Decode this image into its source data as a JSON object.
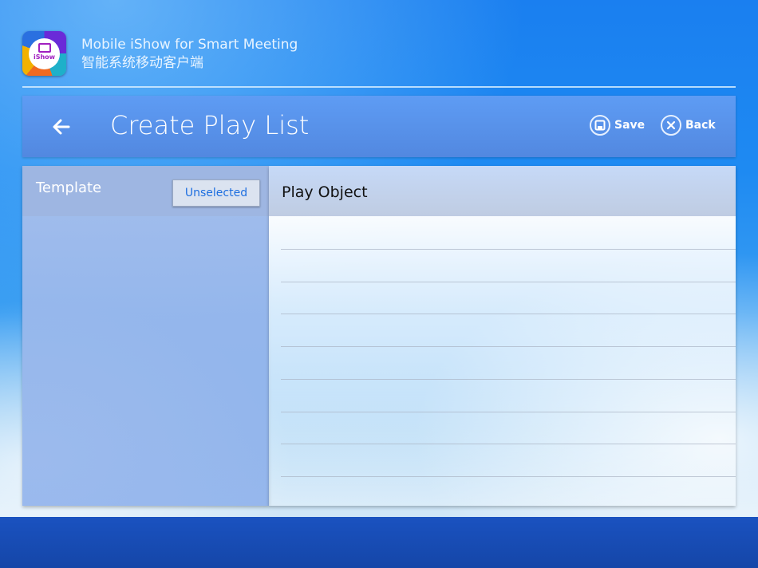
{
  "app": {
    "logo_text": "iShow",
    "title_en": "Mobile iShow for Smart Meeting",
    "title_cn": "智能系统移动客户端"
  },
  "toolbar": {
    "title": "Create Play List",
    "save_label": "Save",
    "back_label": "Back",
    "back_icon": "arrow-left-icon"
  },
  "template": {
    "label": "Template",
    "button_label": "Unselected"
  },
  "play_object": {
    "label": "Play Object",
    "rows": [
      "",
      "",
      "",
      "",
      "",
      "",
      "",
      "",
      ""
    ]
  },
  "colors": {
    "toolbar": "#5b95ec",
    "bottom_bar": "#1a4fb8",
    "accent_text": "#1e6fe0"
  }
}
